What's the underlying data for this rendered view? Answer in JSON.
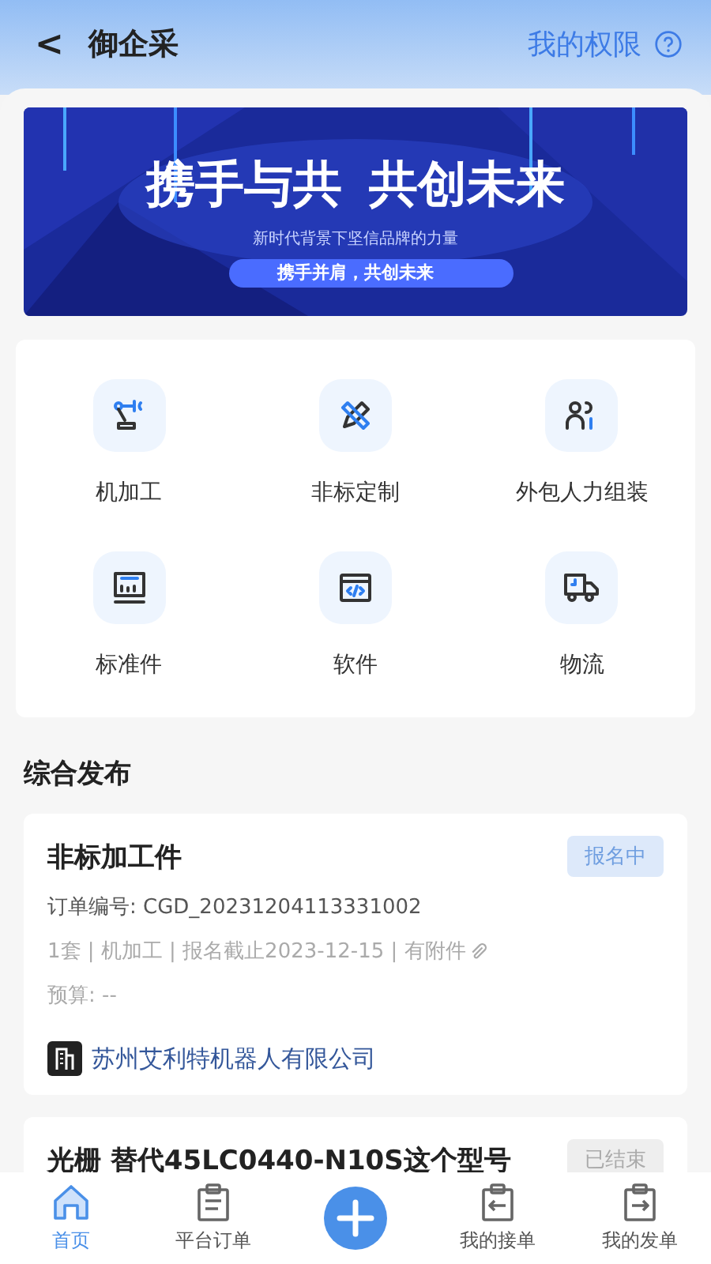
{
  "header": {
    "back": "<",
    "title": "御企采",
    "action": "我的权限"
  },
  "banner": {
    "headline": "携手与共  共创未来",
    "subtitle": "新时代背景下坚信品牌的力量",
    "slogan": "携手并肩，共创未来"
  },
  "categories": [
    {
      "kind": "robot-arm",
      "label": "机加工"
    },
    {
      "kind": "pencil-ruler",
      "label": "非标定制"
    },
    {
      "kind": "people",
      "label": "外包人力组装"
    },
    {
      "kind": "gauge",
      "label": "标准件"
    },
    {
      "kind": "code",
      "label": "软件"
    },
    {
      "kind": "truck",
      "label": "物流"
    }
  ],
  "section_title": "综合发布",
  "orders": [
    {
      "title": "非标加工件",
      "status": {
        "label": "报名中",
        "kind": "active"
      },
      "order_no": "订单编号: CGD_20231204113331002",
      "meta": "1套 | 机加工 | 报名截止2023-12-15 | 有附件",
      "attachment": true,
      "budget": "预算:  --",
      "company": "苏州艾利特机器人有限公司"
    },
    {
      "title": "光栅 替代45LC0440-N10S这个型号",
      "status": {
        "label": "已结束",
        "kind": "ended"
      }
    }
  ],
  "tabs": [
    {
      "label": "首页",
      "kind": "home",
      "selected": true
    },
    {
      "label": "平台订单",
      "kind": "clipboard",
      "selected": false
    },
    {
      "kind": "publish"
    },
    {
      "label": "我的接单",
      "kind": "in",
      "selected": false
    },
    {
      "label": "我的发单",
      "kind": "out",
      "selected": false
    }
  ]
}
